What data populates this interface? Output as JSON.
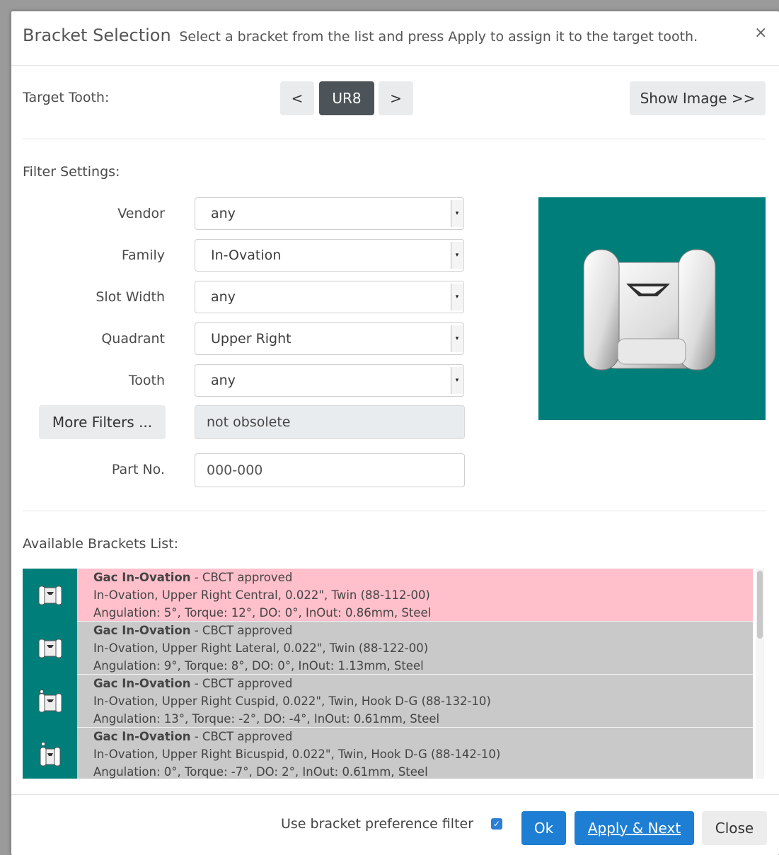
{
  "header": {
    "title": "Bracket Selection",
    "subtitle": "Select a bracket from the list and press Apply to assign it to the target tooth.",
    "close_glyph": "×"
  },
  "target": {
    "label": "Target Tooth:",
    "prev": "<",
    "current": "UR8",
    "next": ">",
    "show_image": "Show Image >>"
  },
  "filters": {
    "heading": "Filter Settings:",
    "vendor": {
      "label": "Vendor",
      "value": "any"
    },
    "family": {
      "label": "Family",
      "value": "In-Ovation"
    },
    "slot_width": {
      "label": "Slot Width",
      "value": "any"
    },
    "quadrant": {
      "label": "Quadrant",
      "value": "Upper Right"
    },
    "tooth": {
      "label": "Tooth",
      "value": "any"
    },
    "more_filters": "More Filters ...",
    "more_value": "not obsolete",
    "part_no": {
      "label": "Part No.",
      "placeholder": "000-000"
    }
  },
  "list": {
    "heading": "Available Brackets List:",
    "rows": [
      {
        "name": "Gac In-Ovation",
        "status": " - CBCT approved",
        "desc": "In-Ovation, Upper Right Central, 0.022\", Twin (88-112-00)",
        "specs": "Angulation: 5°, Torque: 12°, DO: 0°, InOut: 0.86mm, Steel"
      },
      {
        "name": "Gac In-Ovation",
        "status": " - CBCT approved",
        "desc": "In-Ovation, Upper Right Lateral, 0.022\", Twin (88-122-00)",
        "specs": "Angulation: 9°, Torque: 8°, DO: 0°, InOut: 1.13mm, Steel"
      },
      {
        "name": "Gac In-Ovation",
        "status": " - CBCT approved",
        "desc": "In-Ovation, Upper Right Cuspid, 0.022\", Twin, Hook D-G (88-132-10)",
        "specs": "Angulation: 13°, Torque: -2°, DO: -4°, InOut: 0.61mm, Steel"
      },
      {
        "name": "Gac In-Ovation",
        "status": " - CBCT approved",
        "desc": "In-Ovation, Upper Right Bicuspid, 0.022\", Twin, Hook D-G (88-142-10)",
        "specs": "Angulation: 0°, Torque: -7°, DO: 2°, InOut: 0.61mm, Steel"
      }
    ]
  },
  "footer": {
    "pref_filter": "Use bracket preference filter",
    "checkbox_mark": "✓",
    "ok": "Ok",
    "apply_next": "Apply & Next",
    "close": "Close"
  },
  "colors": {
    "preview_bg": "#007f7a",
    "selected_row": "#ffc0cb",
    "row_bg": "#c9c9c9",
    "primary": "#1d7ed3"
  }
}
